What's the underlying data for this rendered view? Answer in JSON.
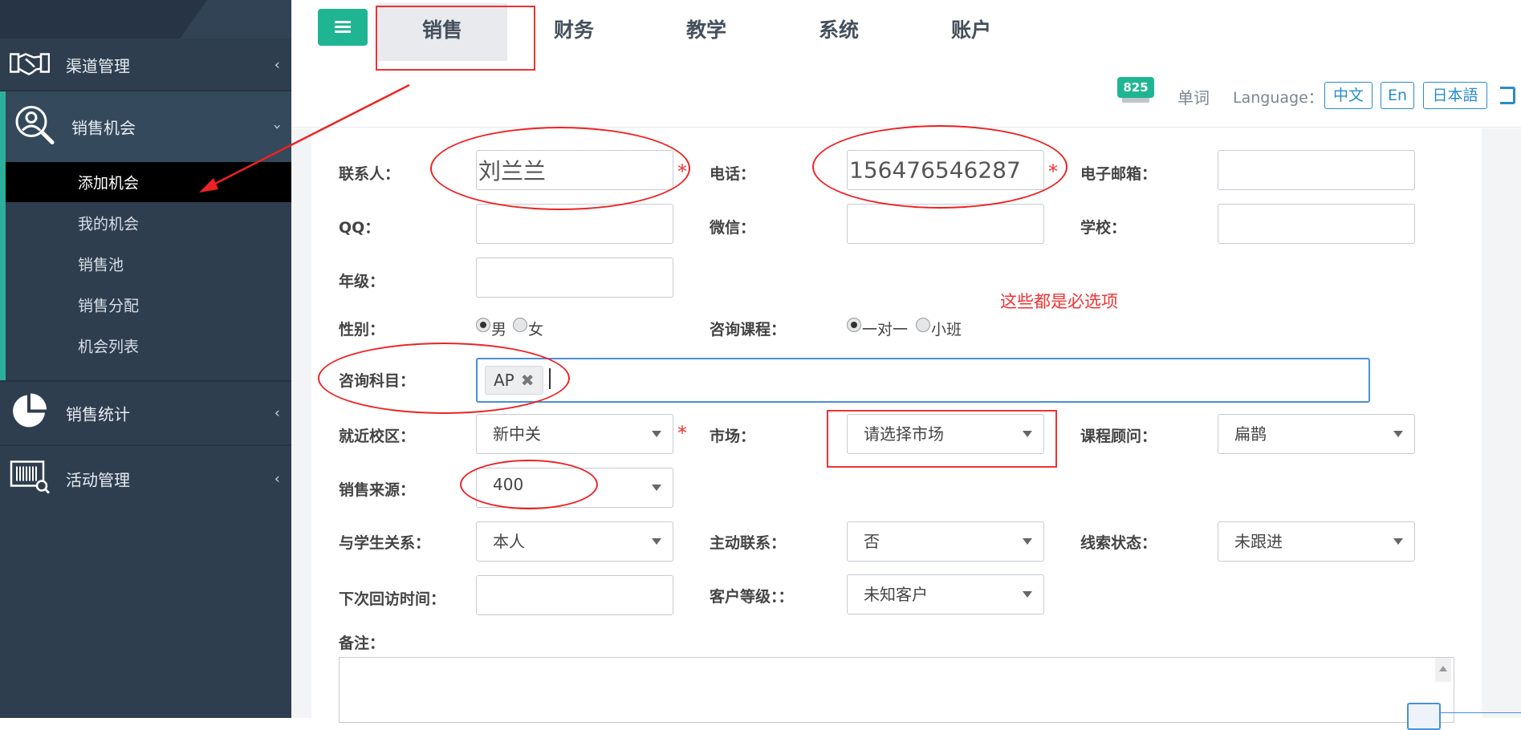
{
  "sidebar": {
    "items": [
      {
        "label": "渠道管理",
        "icon": "handshake-icon"
      },
      {
        "label": "销售机会",
        "icon": "user-search-icon"
      },
      {
        "label": "销售统计",
        "icon": "pie-chart-icon"
      },
      {
        "label": "活动管理",
        "icon": "barcode-scan-icon"
      }
    ],
    "sub_items": [
      {
        "label": "添加机会"
      },
      {
        "label": "我的机会"
      },
      {
        "label": "销售池"
      },
      {
        "label": "销售分配"
      },
      {
        "label": "机会列表"
      }
    ]
  },
  "header": {
    "tabs": [
      {
        "label": "销售"
      },
      {
        "label": "财务"
      },
      {
        "label": "教学"
      },
      {
        "label": "系统"
      },
      {
        "label": "账户"
      }
    ],
    "notification_count": "825",
    "words_label": "单词",
    "language_label": "Language：",
    "languages": [
      "中文",
      "En",
      "日本語"
    ]
  },
  "annotation": {
    "note": "这些都是必选项"
  },
  "form": {
    "contact_label": "联系人：",
    "contact_value": "刘兰兰",
    "phone_label": "电话：",
    "phone_value": "156476546287",
    "email_label": "电子邮箱：",
    "qq_label": "QQ：",
    "wechat_label": "微信：",
    "school_label": "学校：",
    "grade_label": "年级：",
    "gender_label": "性别：",
    "gender_options": [
      "男",
      "女"
    ],
    "course_label": "咨询课程：",
    "course_options": [
      "一对一",
      "小班"
    ],
    "subject_label": "咨询科目：",
    "subject_tag": "AP",
    "subject_tag_remove": "✖",
    "campus_label": "就近校区：",
    "campus_value": "新中关",
    "market_label": "市场：",
    "market_value": "请选择市场",
    "advisor_label": "课程顾问：",
    "advisor_value": "扁鹊",
    "source_label": "销售来源：",
    "source_value": "400",
    "relation_label": "与学生关系：",
    "relation_value": "本人",
    "active_contact_label": "主动联系：",
    "active_contact_value": "否",
    "lead_status_label": "线索状态：",
    "lead_status_value": "未跟进",
    "next_visit_label": "下次回访时间：",
    "customer_level_label": "客户等级：：",
    "customer_level_value": "未知客户",
    "remark_label": "备注：",
    "required_mark": "*"
  }
}
